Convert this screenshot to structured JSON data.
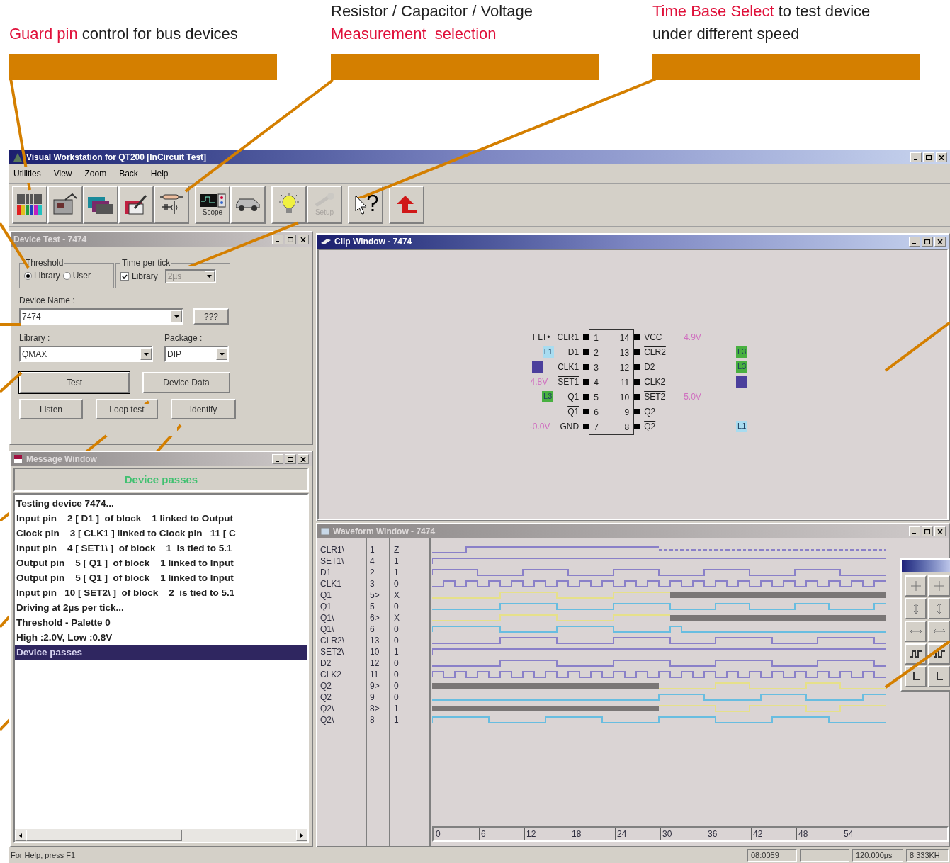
{
  "callouts": [
    {
      "lines": [
        [
          {
            "text": "Guard pin",
            "highlight": true
          },
          {
            "text": " control for bus devices",
            "highlight": false
          }
        ]
      ]
    },
    {
      "lines": [
        [
          {
            "text": "Resistor / Capacitor / Voltage",
            "highlight": false
          }
        ],
        [
          {
            "text": "Measurement  selection",
            "highlight": true
          }
        ]
      ]
    },
    {
      "lines": [
        [
          {
            "text": "Time Base Select",
            "highlight": true
          },
          {
            "text": " to test device",
            "highlight": false
          }
        ],
        [
          {
            "text": "under different speed",
            "highlight": false
          }
        ]
      ]
    }
  ],
  "window": {
    "title": "Visual Workstation for  QT200 [InCircuit Test]"
  },
  "menu": [
    "Utilities",
    "View",
    "Zoom",
    "Back",
    "Help"
  ],
  "toolbar": [
    [
      {
        "kind": "probes",
        "disabled": false
      },
      {
        "kind": "tester",
        "disabled": false
      },
      {
        "kind": "folders",
        "disabled": false
      },
      {
        "kind": "edit",
        "disabled": false
      },
      {
        "kind": "components",
        "disabled": false
      }
    ],
    [
      {
        "kind": "scope",
        "label": "Scope",
        "disabled": false
      },
      {
        "kind": "car",
        "disabled": false
      }
    ],
    [
      {
        "kind": "bulb",
        "disabled": false
      },
      {
        "kind": "setup",
        "label": "Setup",
        "disabled": true
      }
    ],
    [
      {
        "kind": "help",
        "disabled": false
      }
    ],
    [
      {
        "kind": "back",
        "disabled": false
      }
    ]
  ],
  "device_test": {
    "title": "Device Test - 7474",
    "active": false,
    "threshold": {
      "label": "Threshold",
      "options": [
        {
          "label": "Library",
          "selected": true
        },
        {
          "label": "User",
          "selected": false
        }
      ]
    },
    "time_per_tick": {
      "label": "Time per tick",
      "checkbox": {
        "label": "Library",
        "checked": true
      },
      "value": "2µs",
      "disabled": true
    },
    "device_name": {
      "label": "Device Name :",
      "value": "7474"
    },
    "query_button": "???",
    "library": {
      "label": "Library :",
      "value": "QMAX"
    },
    "package": {
      "label": "Package :",
      "value": "DIP"
    },
    "buttons": [
      "Test",
      "Device Data",
      "Listen",
      "Loop test",
      "Identify"
    ]
  },
  "message_window": {
    "title": "Message Window",
    "active": false,
    "banner": "Device passes",
    "lines": [
      {
        "text": "Testing device 7474...",
        "selected": false
      },
      {
        "text": "Input pin    2 [ D1 ]  of block    1 linked to Output",
        "selected": false
      },
      {
        "text": "Clock pin    3 [ CLK1 ] linked to Clock pin   11 [ C",
        "selected": false
      },
      {
        "text": "Input pin    4 [ SET1\\ ]  of block    1  is tied to 5.1",
        "selected": false
      },
      {
        "text": "Output pin    5 [ Q1 ]  of block    1 linked to Input",
        "selected": false
      },
      {
        "text": "Output pin    5 [ Q1 ]  of block    1 linked to Input",
        "selected": false
      },
      {
        "text": "Input pin   10 [ SET2\\ ]  of block    2  is tied to 5.1",
        "selected": false
      },
      {
        "text": "Driving at 2µs per tick...",
        "selected": false
      },
      {
        "text": "Threshold - Palette 0",
        "selected": false
      },
      {
        "text": "High :2.0V, Low :0.8V",
        "selected": false
      },
      {
        "text": "Device passes",
        "selected": true
      }
    ]
  },
  "clip_window": {
    "title": "Clip Window - 7474",
    "active": true,
    "left_pins": [
      {
        "number": "1",
        "name": "CLR1",
        "overline": true,
        "note": "FLT•"
      },
      {
        "number": "2",
        "name": "D1",
        "overline": false,
        "tag": {
          "label": "L1",
          "color": "#a8dcf0"
        }
      },
      {
        "number": "3",
        "name": "CLK1",
        "overline": false,
        "tag": {
          "color": "#4b3f9c"
        }
      },
      {
        "number": "4",
        "name": "SET1",
        "overline": true,
        "voltage": "4.8V"
      },
      {
        "number": "5",
        "name": "Q1",
        "overline": false,
        "tag": {
          "label": "L3",
          "color": "#48b040"
        }
      },
      {
        "number": "6",
        "name": "Q1",
        "overline": true
      },
      {
        "number": "7",
        "name": "GND",
        "overline": false,
        "voltage": "-0.0V"
      }
    ],
    "right_pins": [
      {
        "number": "14",
        "name": "VCC",
        "overline": false,
        "voltage": "4.9V"
      },
      {
        "number": "13",
        "name": "CLR2",
        "overline": true,
        "tag": {
          "label": "L3",
          "color": "#48b040"
        }
      },
      {
        "number": "12",
        "name": "D2",
        "overline": false,
        "tag": {
          "label": "L3",
          "color": "#48b040"
        }
      },
      {
        "number": "11",
        "name": "CLK2",
        "overline": false,
        "tag": {
          "color": "#4b3f9c"
        }
      },
      {
        "number": "10",
        "name": "SET2",
        "overline": true,
        "voltage": "5.0V"
      },
      {
        "number": "9",
        "name": "Q2",
        "overline": false
      },
      {
        "number": "8",
        "name": "Q2",
        "overline": true,
        "tag": {
          "label": "L1",
          "color": "#a8dcf0"
        }
      }
    ]
  },
  "waveform_window": {
    "title": "Waveform Window - 7474",
    "active": false,
    "signals": [
      {
        "name": "CLR1\\",
        "pin": "1",
        "value": "Z",
        "color": "#8a80c8"
      },
      {
        "name": "SET1\\",
        "pin": "4",
        "value": "1",
        "color": "#8a80c8"
      },
      {
        "name": "D1",
        "pin": "2",
        "value": "1",
        "color": "#8a80c8"
      },
      {
        "name": "CLK1",
        "pin": "3",
        "value": "0",
        "color": "#8a80c8"
      },
      {
        "name": "Q1",
        "pin": "5>",
        "value": "X",
        "color": "#e6e08a"
      },
      {
        "name": "Q1",
        "pin": "5",
        "value": "0",
        "color": "#68bde0"
      },
      {
        "name": "Q1\\",
        "pin": "6>",
        "value": "X",
        "color": "#e6e08a"
      },
      {
        "name": "Q1\\",
        "pin": "6",
        "value": "0",
        "color": "#68bde0"
      },
      {
        "name": "CLR2\\",
        "pin": "13",
        "value": "0",
        "color": "#8a80c8"
      },
      {
        "name": "SET2\\",
        "pin": "10",
        "value": "1",
        "color": "#8a80c8"
      },
      {
        "name": "D2",
        "pin": "12",
        "value": "0",
        "color": "#8a80c8"
      },
      {
        "name": "CLK2",
        "pin": "11",
        "value": "0",
        "color": "#8a80c8"
      },
      {
        "name": "Q2",
        "pin": "9>",
        "value": "0",
        "color": "#e6e08a"
      },
      {
        "name": "Q2",
        "pin": "9",
        "value": "0",
        "color": "#68bde0"
      },
      {
        "name": "Q2\\",
        "pin": "8>",
        "value": "1",
        "color": "#e6e08a"
      },
      {
        "name": "Q2\\",
        "pin": "8",
        "value": "1",
        "color": "#68bde0"
      }
    ],
    "time_axis": [
      "0",
      "6",
      "12",
      "18",
      "24",
      "30",
      "36",
      "42",
      "48",
      "54"
    ]
  },
  "status_bar": {
    "help": "For Help, press F1",
    "panels": [
      "08:0059",
      "120.000µs",
      "8.333KH"
    ]
  }
}
